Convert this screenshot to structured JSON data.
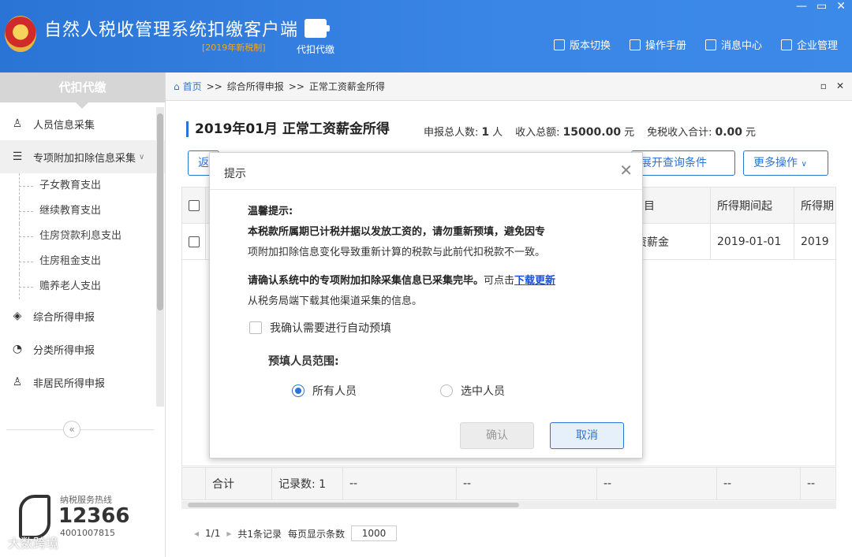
{
  "header": {
    "title": "自然人税收管理系统扣缴客户端",
    "badge": "[2019年新税制]",
    "module_label": "代扣代缴",
    "nav": [
      "版本切换",
      "操作手册",
      "消息中心",
      "企业管理"
    ]
  },
  "sidebar": {
    "title": "代扣代缴",
    "items": [
      {
        "label": "人员信息采集",
        "icon": "person-icon"
      },
      {
        "label": "专项附加扣除信息采集",
        "icon": "list-icon"
      },
      {
        "label": "综合所得申报",
        "icon": "layers-icon"
      },
      {
        "label": "分类所得申报",
        "icon": "clock-icon"
      },
      {
        "label": "非居民所得申报",
        "icon": "person-outline-icon"
      }
    ],
    "subitems": [
      "子女教育支出",
      "继续教育支出",
      "住房贷款利息支出",
      "住房租金支出",
      "赡养老人支出"
    ],
    "hotline_label": "纳税服务热线",
    "hotline_number": "12366",
    "hotline_sub": "4001007815",
    "watermark": "大数跨境"
  },
  "breadcrumb": {
    "home": "首页",
    "sep": ">>",
    "level1": "综合所得申报",
    "level2": "正常工资薪金所得"
  },
  "main": {
    "title": "2019年01月 正常工资薪金所得",
    "stats": {
      "count_label": "申报总人数:",
      "count": "1",
      "count_unit": "人",
      "income_label": "收入总额:",
      "income": "15000.00",
      "income_unit": "元",
      "exempt_label": "免税收入合计:",
      "exempt": "0.00",
      "exempt_unit": "元"
    },
    "buttons": {
      "left_partial": "返",
      "expand_query": "展开查询条件",
      "more_ops": "更多操作"
    },
    "table": {
      "headers": [
        "",
        "",
        "",
        "",
        "目",
        "所得期间起",
        "所得期"
      ],
      "row": [
        "",
        "",
        "",
        "",
        "资薪金",
        "2019-01-01",
        "2019"
      ],
      "summary": [
        "",
        "合计",
        "记录数: 1",
        "--",
        "--",
        "--",
        "--",
        "--"
      ]
    },
    "pager": {
      "page": "1/1",
      "total": "共1条记录",
      "page_size_label": "每页显示条数",
      "page_size": "1000"
    }
  },
  "dialog": {
    "title": "提示",
    "tip_heading": "温馨提示:",
    "tip_bold": "本税款所属期已计税并据以发放工资的，请勿重新预填，避免因专",
    "tip_normal": "项附加扣除信息变化导致重新计算的税款与此前代扣税款不一致。",
    "confirm_bold": "请确认系统中的专项附加扣除采集信息已采集完毕。",
    "confirm_normal": "可点击",
    "download_link": "下载更新",
    "from_text": "从税务局端下载其他渠道采集的信息。",
    "checkbox_label": "我确认需要进行自动预填",
    "range_label": "预填人员范围:",
    "radio_all": "所有人员",
    "radio_selected": "选中人员",
    "ok": "确认",
    "cancel": "取消"
  },
  "colors": {
    "header_blue": "#2a74d6",
    "accent": "#2a74d6",
    "link": "#1a4fd0",
    "badge": "#f5a623"
  }
}
